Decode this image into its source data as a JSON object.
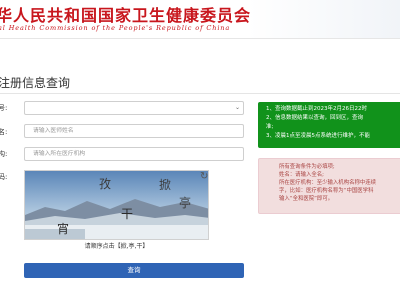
{
  "header": {
    "logo_cn": "华人民共和国国家卫生健康委员会",
    "logo_en": "al Health Commission of the People's Republic of China"
  },
  "page": {
    "title": "注册信息查询"
  },
  "form": {
    "row1": {
      "label": "号:",
      "value": ""
    },
    "row2": {
      "label": "名:",
      "placeholder": "请输入医师姓名"
    },
    "row3": {
      "label": "构:",
      "placeholder": "请输入所在医疗机构"
    },
    "row4": {
      "label": "码:"
    },
    "captcha": {
      "chars": [
        "孜",
        "掀",
        "亭",
        "干",
        "宵"
      ],
      "hint": "请顺序点击【掀,亭,干】"
    },
    "submit_label": "查询"
  },
  "notice": {
    "lines": [
      "1、查询数据截止到2023年2月26日22时",
      "2、信息数据结果以查询，回到区，查询",
      "准;",
      "3、凌晨1点至凌晨5点系统进行维护，不能"
    ]
  },
  "tips": {
    "lines": [
      "所有查询条件为必填项;",
      "姓名：请输入全名;",
      "所在医疗机构：至少输入机构名称中连续",
      "字，比如：医疗机构名称为“中国医学科",
      "输入“全和医院”即可。"
    ]
  },
  "colors": {
    "brand_red": "#c8161d",
    "primary_blue": "#2f64b5",
    "notice_green": "#11921b"
  }
}
